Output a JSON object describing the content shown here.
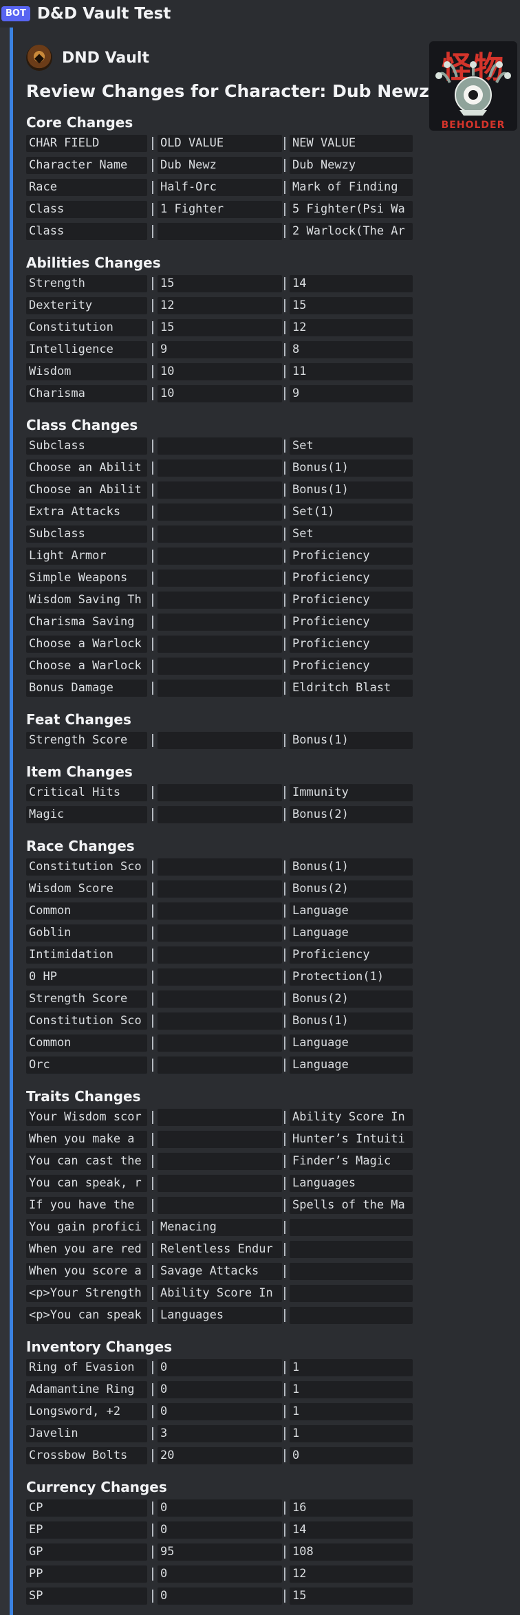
{
  "app": {
    "bot_tag": "BOT",
    "channel_title": "D&D Vault Test"
  },
  "embed": {
    "author_name": "DND Vault",
    "title": "Review Changes for Character: Dub Newz",
    "thumbnail": {
      "kanji": "怪物",
      "label": "BEHOLDER"
    },
    "accent_color": "#3b82e0"
  },
  "sections": [
    {
      "title": "Core Changes",
      "rows": [
        [
          "CHAR FIELD",
          "OLD VALUE",
          "NEW VALUE"
        ],
        [
          "Character Name",
          "Dub Newz",
          "Dub Newzy"
        ],
        [
          "Race",
          "Half-Orc",
          "Mark of Finding"
        ],
        [
          "Class",
          "1 Fighter",
          "5 Fighter(Psi Wa"
        ],
        [
          "Class",
          "",
          "2 Warlock(The Ar"
        ]
      ]
    },
    {
      "title": "Abilities Changes",
      "rows": [
        [
          "Strength",
          "15",
          "14"
        ],
        [
          "Dexterity",
          "12",
          "15"
        ],
        [
          "Constitution",
          "15",
          "12"
        ],
        [
          "Intelligence",
          "9",
          "8"
        ],
        [
          "Wisdom",
          "10",
          "11"
        ],
        [
          "Charisma",
          "10",
          "9"
        ]
      ]
    },
    {
      "title": "Class Changes",
      "rows": [
        [
          "Subclass",
          "",
          "Set"
        ],
        [
          "Choose an Abilit",
          "",
          "Bonus(1)"
        ],
        [
          "Choose an Abilit",
          "",
          "Bonus(1)"
        ],
        [
          "Extra Attacks",
          "",
          "Set(1)"
        ],
        [
          "Subclass",
          "",
          "Set"
        ],
        [
          "Light Armor",
          "",
          "Proficiency"
        ],
        [
          "Simple Weapons",
          "",
          "Proficiency"
        ],
        [
          "Wisdom Saving Th",
          "",
          "Proficiency"
        ],
        [
          "Charisma Saving",
          "",
          "Proficiency"
        ],
        [
          "Choose a Warlock",
          "",
          "Proficiency"
        ],
        [
          "Choose a Warlock",
          "",
          "Proficiency"
        ],
        [
          "Bonus Damage",
          "",
          "Eldritch Blast"
        ]
      ]
    },
    {
      "title": "Feat Changes",
      "rows": [
        [
          "Strength Score",
          "",
          "Bonus(1)"
        ]
      ]
    },
    {
      "title": "Item Changes",
      "rows": [
        [
          "Critical Hits",
          "",
          "Immunity"
        ],
        [
          "Magic",
          "",
          "Bonus(2)"
        ]
      ]
    },
    {
      "title": "Race Changes",
      "rows": [
        [
          "Constitution Sco",
          "",
          "Bonus(1)"
        ],
        [
          "Wisdom Score",
          "",
          "Bonus(2)"
        ],
        [
          "Common",
          "",
          "Language"
        ],
        [
          "Goblin",
          "",
          "Language"
        ],
        [
          "Intimidation",
          "",
          "Proficiency"
        ],
        [
          "0 HP",
          "",
          "Protection(1)"
        ],
        [
          "Strength Score",
          "",
          "Bonus(2)"
        ],
        [
          "Constitution Sco",
          "",
          "Bonus(1)"
        ],
        [
          "Common",
          "",
          "Language"
        ],
        [
          "Orc",
          "",
          "Language"
        ]
      ]
    },
    {
      "title": "Traits Changes",
      "rows": [
        [
          "Your Wisdom scor",
          "",
          "Ability Score In"
        ],
        [
          "When you make a",
          "",
          "Hunter’s Intuiti"
        ],
        [
          "You can cast the",
          "",
          "Finder’s Magic"
        ],
        [
          "You can speak, r",
          "",
          "Languages"
        ],
        [
          "If you have the",
          "",
          "Spells of the Ma"
        ],
        [
          "You gain profici",
          "Menacing",
          ""
        ],
        [
          "When you are red",
          "Relentless Endur",
          ""
        ],
        [
          "When you score a",
          "Savage Attacks",
          ""
        ],
        [
          "<p>Your Strength",
          "Ability Score In",
          ""
        ],
        [
          "<p>You can speak",
          "Languages",
          ""
        ]
      ]
    },
    {
      "title": "Inventory Changes",
      "rows": [
        [
          "Ring of Evasion",
          "0",
          "1"
        ],
        [
          "Adamantine Ring",
          "0",
          "1"
        ],
        [
          "Longsword, +2",
          "0",
          "1"
        ],
        [
          "Javelin",
          "3",
          "1"
        ],
        [
          "Crossbow Bolts",
          "20",
          "0"
        ]
      ]
    },
    {
      "title": "Currency Changes",
      "rows": [
        [
          "CP",
          "0",
          "16"
        ],
        [
          "EP",
          "0",
          "14"
        ],
        [
          "GP",
          "95",
          "108"
        ],
        [
          "PP",
          "0",
          "12"
        ],
        [
          "SP",
          "0",
          "15"
        ]
      ]
    }
  ]
}
